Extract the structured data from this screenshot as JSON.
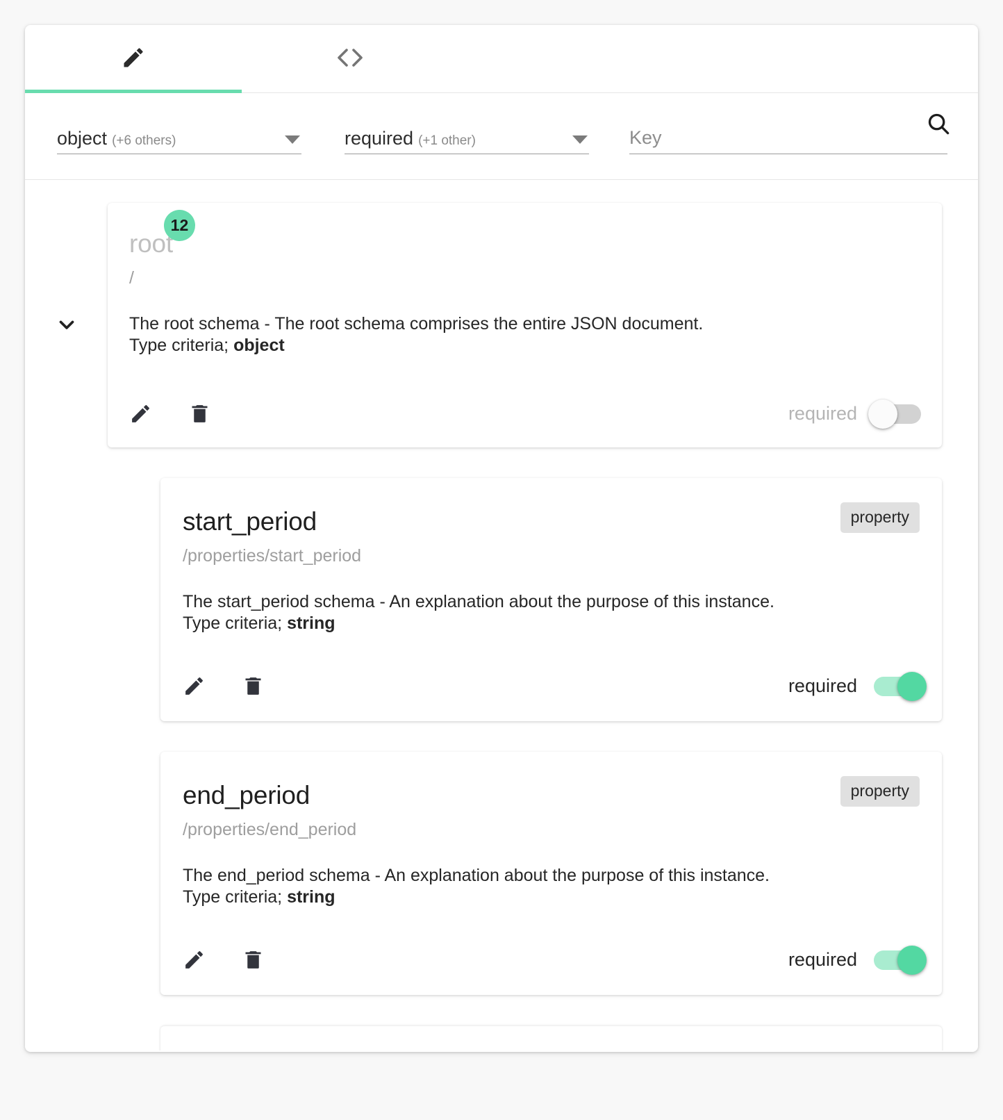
{
  "tabs": [
    {
      "id": "editor",
      "icon": "pencil-icon",
      "active": true
    },
    {
      "id": "code",
      "icon": "code-brackets-icon",
      "active": false
    }
  ],
  "toolbar": {
    "type_select": {
      "value": "object",
      "extra": "(+6 others)"
    },
    "state_select": {
      "value": "required",
      "extra": "(+1 other)"
    },
    "search": {
      "value": "",
      "placeholder": "Key",
      "icon": "search-icon"
    }
  },
  "nodes": [
    {
      "name": "root",
      "badge": "12",
      "path": "/",
      "description_line1": "The root schema - The root schema comprises the entire JSON document.",
      "description_line2_prefix": "Type criteria; ",
      "description_line2_type": "object",
      "kind_chip": "",
      "required_label": "required",
      "required_on": false,
      "edit_icon": "pencil-icon",
      "delete_icon": "trash-icon",
      "expander_icon": "chevron-down-icon"
    },
    {
      "name": "start_period",
      "badge": "",
      "path": "/properties/start_period",
      "description_line1": "The start_period schema - An explanation about the purpose of this instance.",
      "description_line2_prefix": "Type criteria; ",
      "description_line2_type": "string",
      "kind_chip": "property",
      "required_label": "required",
      "required_on": true,
      "edit_icon": "pencil-icon",
      "delete_icon": "trash-icon"
    },
    {
      "name": "end_period",
      "badge": "",
      "path": "/properties/end_period",
      "description_line1": "The end_period schema - An explanation about the purpose of this instance.",
      "description_line2_prefix": "Type criteria; ",
      "description_line2_type": "string",
      "kind_chip": "property",
      "required_label": "required",
      "required_on": true,
      "edit_icon": "pencil-icon",
      "delete_icon": "trash-icon"
    }
  ],
  "colors": {
    "accent_green": "#68dcae",
    "toggle_on_track": "#a9ecd0",
    "toggle_on_knob": "#53d8a2",
    "toggle_off_track": "#d2d2d2",
    "chip_bg": "#e0e0e0",
    "page_bg": "#f8f8f8"
  }
}
